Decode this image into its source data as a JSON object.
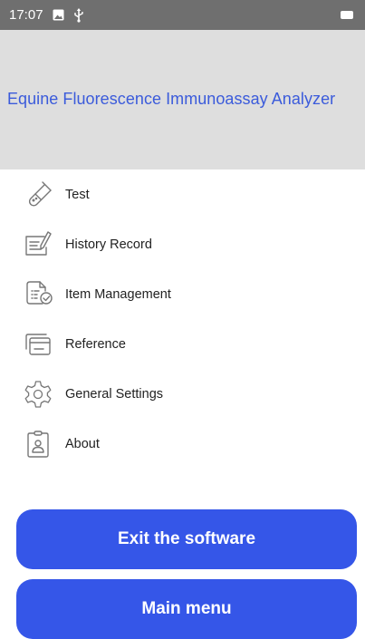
{
  "status_bar": {
    "time": "17:07",
    "icons": [
      "image-icon",
      "usb-icon",
      "battery-icon"
    ]
  },
  "header": {
    "title": "Equine Fluorescence Immunoassay Analyzer"
  },
  "menu": {
    "items": [
      {
        "label": "Test",
        "icon": "test-tube-icon"
      },
      {
        "label": "History Record",
        "icon": "history-record-icon"
      },
      {
        "label": "Item Management",
        "icon": "item-management-icon"
      },
      {
        "label": "Reference",
        "icon": "reference-icon"
      },
      {
        "label": "General Settings",
        "icon": "gear-icon"
      },
      {
        "label": "About",
        "icon": "about-icon"
      }
    ]
  },
  "buttons": {
    "exit_label": "Exit the software",
    "main_menu_label": "Main menu"
  },
  "colors": {
    "accent": "#3556e8",
    "title_text": "#3b5bdb",
    "banner_bg": "#dedede",
    "status_bar_bg": "#6f6f6f"
  }
}
